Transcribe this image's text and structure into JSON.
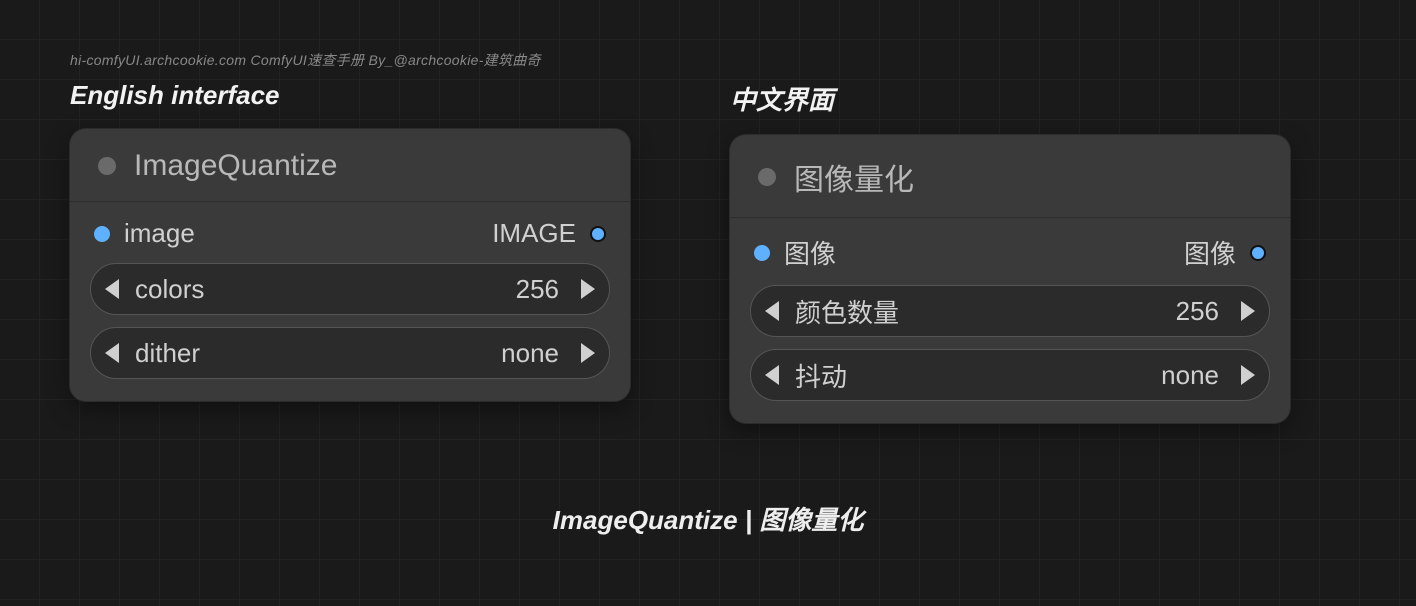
{
  "watermark": "hi-comfyUI.archcookie.com ComfyUI速查手册 By_@archcookie-建筑曲奇",
  "en": {
    "heading": "English interface",
    "node_title": "ImageQuantize",
    "input_label": "image",
    "output_label": "IMAGE",
    "params": [
      {
        "label": "colors",
        "value": "256"
      },
      {
        "label": "dither",
        "value": "none"
      }
    ]
  },
  "zh": {
    "heading": "中文界面",
    "node_title": "图像量化",
    "input_label": "图像",
    "output_label": "图像",
    "params": [
      {
        "label": "颜色数量",
        "value": "256"
      },
      {
        "label": "抖动",
        "value": "none"
      }
    ]
  },
  "caption": "ImageQuantize | 图像量化"
}
